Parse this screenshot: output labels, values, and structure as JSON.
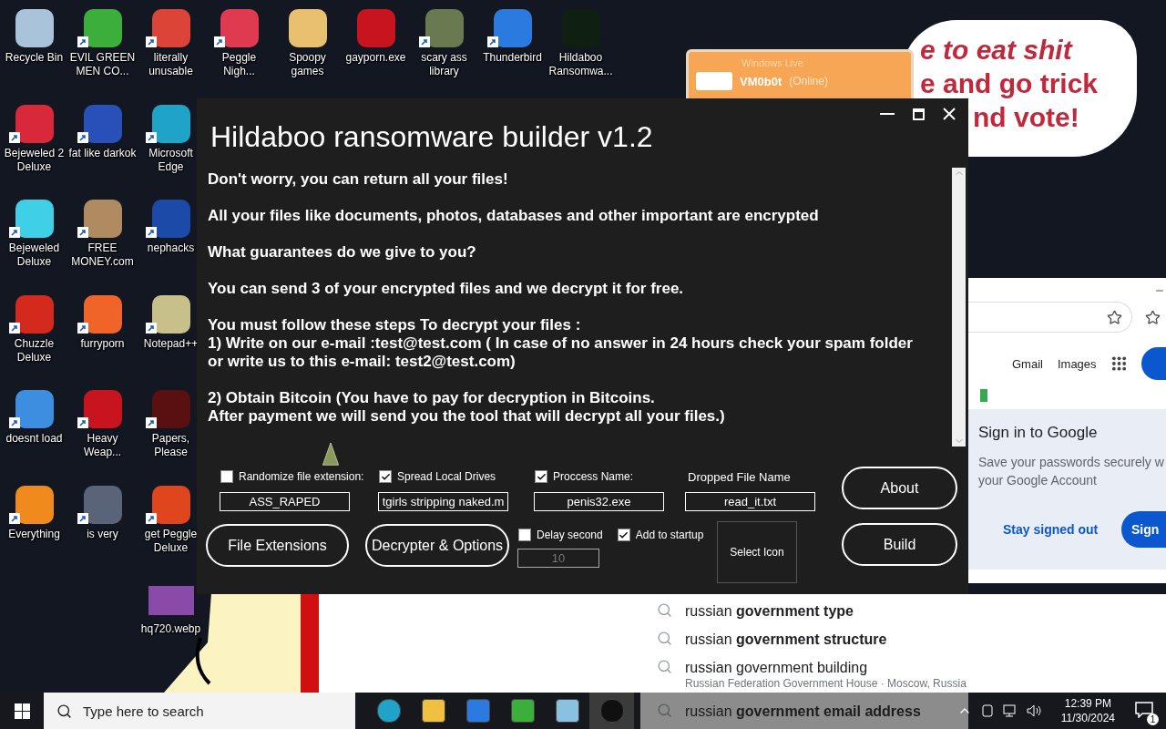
{
  "desktop_columns": [
    [
      {
        "label": "Recycle Bin",
        "kind": "app",
        "color": "#a9c4da",
        "shortcut": false
      },
      {
        "label": "Bejeweled 2 Deluxe",
        "kind": "app",
        "color": "#d8283a",
        "shortcut": true
      },
      {
        "label": "Bejeweled Deluxe",
        "kind": "app",
        "color": "#3fd0e8",
        "shortcut": true
      },
      {
        "label": "Chuzzle Deluxe",
        "kind": "app",
        "color": "#d42a1e",
        "shortcut": true
      },
      {
        "label": "doesnt load",
        "kind": "app",
        "color": "#3d8ee0",
        "shortcut": true
      },
      {
        "label": "Everything",
        "kind": "app",
        "color": "#f08a1c",
        "shortcut": true
      }
    ],
    [
      {
        "label": "EVIL GREEN MEN CO...",
        "kind": "app",
        "color": "#3cae3c",
        "shortcut": true
      },
      {
        "label": "fat like darkok",
        "kind": "app",
        "color": "#2850b8",
        "shortcut": true
      },
      {
        "label": "FREE MONEY.com",
        "kind": "app",
        "color": "#b08a60",
        "shortcut": true
      },
      {
        "label": "furryporn",
        "kind": "app",
        "color": "#f0642a",
        "shortcut": true
      },
      {
        "label": "Heavy Weap...",
        "kind": "app",
        "color": "#c8141e",
        "shortcut": true
      },
      {
        "label": "is very",
        "kind": "app",
        "color": "#5a6478",
        "shortcut": true
      }
    ],
    [
      {
        "label": "literally unusable",
        "kind": "app",
        "color": "#db4437",
        "shortcut": true
      },
      {
        "label": "Microsoft Edge",
        "kind": "app",
        "color": "#1fa3c8",
        "shortcut": true
      },
      {
        "label": "nephacks",
        "kind": "app",
        "color": "#1c4aa8",
        "shortcut": true
      },
      {
        "label": "Notepad++",
        "kind": "app",
        "color": "#c8c08a",
        "shortcut": true
      },
      {
        "label": "Papers, Please",
        "kind": "app",
        "color": "#5a1010",
        "shortcut": true
      },
      {
        "label": "get Peggle Deluxe",
        "kind": "app",
        "color": "#e0461e",
        "shortcut": true
      },
      {
        "label": "hq720.webp",
        "kind": "thumbnail",
        "color": "#8a4aa8",
        "shortcut": false
      }
    ],
    [
      {
        "label": "Peggle Nigh...",
        "kind": "app",
        "color": "#e03a50",
        "shortcut": true
      }
    ],
    [
      {
        "label": "Spoopy games",
        "kind": "app",
        "color": "#e8c070",
        "shortcut": false
      }
    ],
    [
      {
        "label": "gayporn.exe",
        "kind": "app",
        "color": "#c8141e",
        "shortcut": false
      }
    ],
    [
      {
        "label": "scary ass library",
        "kind": "app",
        "color": "#6a7a50",
        "shortcut": true
      }
    ],
    [
      {
        "label": "Thunderbird",
        "kind": "app",
        "color": "#2a7ae0",
        "shortcut": true
      }
    ],
    [
      {
        "label": "Hildaboo Ransomwa...",
        "kind": "app",
        "color": "#102010",
        "shortcut": false
      }
    ]
  ],
  "wallpaper_bubble": [
    "e to eat shit",
    "e and go trick",
    "nd vote!"
  ],
  "messenger": {
    "title": "Windows Live",
    "name": "VM0b0t",
    "status": "(Online)"
  },
  "browser": {
    "links": [
      "Gmail",
      "Images"
    ],
    "card": {
      "title": "Sign in to Google",
      "text": "Save your passwords securely w your Google Account",
      "secondary": "Stay signed out",
      "primary": "Sign"
    },
    "suggestions": [
      {
        "text": "russian **government type**"
      },
      {
        "text": "russian **government structure**"
      },
      {
        "text": "russian government building",
        "detail": "Russian Federation Government House · Moscow, Russia"
      },
      {
        "text": "russian **government email address**"
      }
    ]
  },
  "builder": {
    "title": "Hildaboo ransomware builder v1.2",
    "message": [
      [
        "Don't worry, you can return all your files!"
      ],
      [
        "All your files like documents, photos, databases and other important are encrypted"
      ],
      [
        "What guarantees do we give to you?"
      ],
      [
        "You can send 3 of your encrypted files and we decrypt it for free."
      ],
      [
        "You must follow these steps To decrypt your files :",
        "1) Write on our e-mail :test@test.com ( In case of no answer in 24 hours check your spam folder",
        "or write us to this e-mail: test2@test.com)"
      ],
      [
        "2) Obtain Bitcoin (You have to pay for decryption in Bitcoins.",
        "After payment we will send you the tool that will decrypt all your files.)"
      ]
    ],
    "settings": [
      {
        "kind": "checkbox",
        "label": "Randomize file extension:",
        "checked": false,
        "value": "ASS_RAPED"
      },
      {
        "kind": "checkbox",
        "label": "Spread Local Drives",
        "checked": true,
        "value": "tgirls stripping naked.m"
      },
      {
        "kind": "checkbox",
        "label": "Proccess Name:",
        "checked": true,
        "value": "penis32.exe"
      },
      {
        "kind": "label",
        "label": "Dropped File Name",
        "value": "read_it.txt"
      }
    ],
    "left_buttons": [
      "File Extensions",
      "Decrypter & Options"
    ],
    "delay": {
      "label": "Delay second",
      "checked": false,
      "value": "10",
      "disabled": true
    },
    "startup": {
      "label": "Add to startup",
      "checked": true
    },
    "icon_picker": "Select Icon",
    "right_buttons": [
      "About",
      "Build"
    ]
  },
  "taskbar": {
    "search_placeholder": "Type here to search",
    "apps": [
      {
        "color": "#1fa3c8",
        "selected": false
      },
      {
        "color": "#f0c040",
        "selected": false
      },
      {
        "color": "#2a7ae0",
        "selected": false
      },
      {
        "color": "#3cae3c",
        "selected": false
      },
      {
        "color": "#8ac0e0",
        "selected": false
      },
      {
        "color": "#101010",
        "selected": true
      }
    ],
    "time": "12:39 PM",
    "date": "11/30/2024",
    "notifications": "1"
  }
}
